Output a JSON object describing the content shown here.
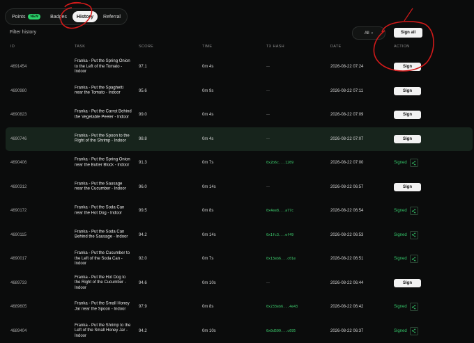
{
  "tabs": [
    {
      "label": "Points",
      "badge": "NEW",
      "active": false
    },
    {
      "label": "Badges",
      "active": false
    },
    {
      "label": "History",
      "active": true
    },
    {
      "label": "Referral",
      "active": false
    }
  ],
  "filter": {
    "label": "Filter history",
    "selected": "All",
    "sign_all_label": "Sign all"
  },
  "columns": {
    "id": "ID",
    "task": "TASK",
    "score": "SCORE",
    "time": "TIME",
    "hash": "TX HASH",
    "date": "DATE",
    "action": "ACTION"
  },
  "rows": [
    {
      "id": "4691454",
      "task": "Franka - Put the Spring Onion to the Left of the Tomato - Indoor",
      "score": "97.1",
      "time": "0m 4s",
      "hash": "—",
      "date": "2026-08-22 07:24",
      "action": "Sign"
    },
    {
      "id": "4690980",
      "task": "Franka - Put the Spaghetti near the Tomato - Indoor",
      "score": "95.6",
      "time": "0m 9s",
      "hash": "—",
      "date": "2026-08-22 07:11",
      "action": "Sign"
    },
    {
      "id": "4690823",
      "task": "Franka - Put the Carrot Behind the Vegetable Peeler - Indoor",
      "score": "99.0",
      "time": "0m 4s",
      "hash": "—",
      "date": "2026-08-22 07:09",
      "action": "Sign"
    },
    {
      "id": "4690746",
      "task": "Franka - Put the Spoon to the Right of the Shrimp - Indoor",
      "score": "98.8",
      "time": "0m 4s",
      "hash": "—",
      "date": "2026-08-22 07:07",
      "action": "Sign",
      "highlight": true
    },
    {
      "id": "4690406",
      "task": "Franka - Put the Spring Onion near the Butter Block - Indoor",
      "score": "91.3",
      "time": "0m 7s",
      "hash": "0x2b6c...1269",
      "date": "2026-08-22 07:00",
      "action": "Signed"
    },
    {
      "id": "4690312",
      "task": "Franka - Put the Sausage near the Cucumber - Indoor",
      "score": "96.0",
      "time": "0m 14s",
      "hash": "—",
      "date": "2026-08-22 06:57",
      "action": "Sign"
    },
    {
      "id": "4690172",
      "task": "Franka - Put the Soda Can near the Hot Dog - Indoor",
      "score": "99.5",
      "time": "0m 8s",
      "hash": "0x4ee8...a77c",
      "date": "2026-08-22 06:54",
      "action": "Signed"
    },
    {
      "id": "4690115",
      "task": "Franka - Put the Soda Can Behind the Sausage - Indoor",
      "score": "94.2",
      "time": "0m 14s",
      "hash": "0x1fc3...ef49",
      "date": "2026-08-22 06:53",
      "action": "Signed"
    },
    {
      "id": "4690017",
      "task": "Franka - Put the Cucumber to the Left of the Soda Can - Indoor",
      "score": "92.0",
      "time": "0m 7s",
      "hash": "0x13eb6...c01e",
      "date": "2026-08-22 06:51",
      "action": "Signed"
    },
    {
      "id": "4689733",
      "task": "Franka - Put the Hot Dog to the Right of the Cucumber - Indoor",
      "score": "94.6",
      "time": "0m 10s",
      "hash": "—",
      "date": "2026-08-22 06:44",
      "action": "Sign"
    },
    {
      "id": "4689605",
      "task": "Franka - Put the Small Honey Jar near the Spoon - Indoor",
      "score": "97.9",
      "time": "0m 8s",
      "hash": "0x233eb6...4e43",
      "date": "2026-08-22 06:42",
      "action": "Signed"
    },
    {
      "id": "4689404",
      "task": "Franka - Put the Shrimp to the Left of the Small Honey Jar - Indoor",
      "score": "94.2",
      "time": "0m 10s",
      "hash": "0x0d599...c695",
      "date": "2026-08-22 06:37",
      "action": "Signed"
    }
  ],
  "colors": {
    "accent": "#34c76a",
    "highlight_row": "#17241c",
    "annotation": "#d11a1a"
  },
  "icons": {
    "share": "share-icon",
    "dropdown": "chevron-down-icon"
  }
}
